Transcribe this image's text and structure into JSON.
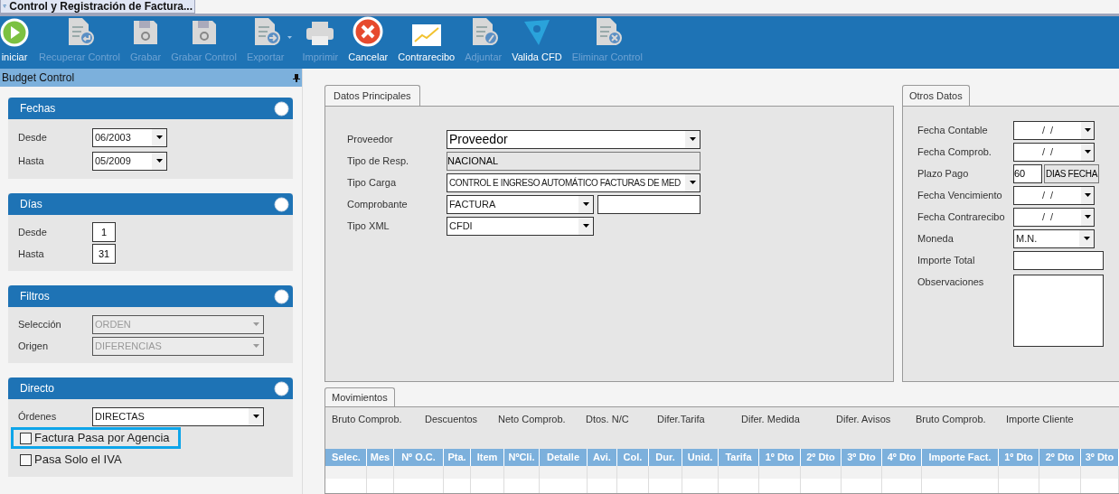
{
  "window": {
    "title": "Control y Registración de Factura..."
  },
  "toolbar": [
    {
      "label": "iniciar",
      "kind": "play",
      "disabled": false
    },
    {
      "label": "Recuperar Control",
      "kind": "doc-return",
      "disabled": true
    },
    {
      "label": "Grabar",
      "kind": "floppy",
      "disabled": true
    },
    {
      "label": "Grabar Control",
      "kind": "floppy",
      "disabled": true
    },
    {
      "label": "Exportar",
      "kind": "doc-export",
      "disabled": true,
      "dropdown": true
    },
    {
      "label": "Imprimir",
      "kind": "printer",
      "disabled": true
    },
    {
      "label": "Cancelar",
      "kind": "cancel",
      "disabled": false
    },
    {
      "label": "Contrarecibo",
      "kind": "chart",
      "disabled": false
    },
    {
      "label": "Adjuntar",
      "kind": "doc-clip",
      "disabled": true
    },
    {
      "label": "Valida CFD",
      "kind": "cfd",
      "disabled": false
    },
    {
      "label": "Eliminar Control",
      "kind": "doc-delete",
      "disabled": true
    }
  ],
  "side_panel": {
    "title": "Budget Control",
    "sections": [
      {
        "title": "Fechas",
        "fields": [
          {
            "label": "Desde",
            "kind": "combo",
            "value": "06/2003",
            "disabled": false
          },
          {
            "label": "Hasta",
            "kind": "combo",
            "value": "05/2009",
            "disabled": false
          }
        ]
      },
      {
        "title": "Días",
        "fields": [
          {
            "label": "Desde",
            "kind": "number",
            "value": "1"
          },
          {
            "label": "Hasta",
            "kind": "number",
            "value": "31"
          }
        ]
      },
      {
        "title": "Filtros",
        "fields": [
          {
            "label": "Selección",
            "kind": "combo-wide",
            "value": "ORDEN",
            "disabled": true
          },
          {
            "label": "Origen",
            "kind": "combo-wide",
            "value": "DIFERENCIAS",
            "disabled": true
          }
        ]
      },
      {
        "title": "Directo",
        "fields": [
          {
            "label": "Órdenes",
            "kind": "combo-wide",
            "value": "DIRECTAS",
            "disabled": false
          },
          {
            "label": "Factura Pasa por Agencia",
            "kind": "checkbox",
            "checked": false,
            "highlighted": true
          },
          {
            "label": "Pasa Solo el IVA",
            "kind": "checkbox",
            "checked": false,
            "highlighted": false
          }
        ]
      }
    ]
  },
  "datos_principales": {
    "tab": "Datos Principales",
    "fields": [
      {
        "label": "Proveedor",
        "kind": "combo-large",
        "value": "Proveedor"
      },
      {
        "label": "Tipo de Resp.",
        "kind": "readonly",
        "value": "NACIONAL"
      },
      {
        "label": "Tipo Carga",
        "kind": "combo",
        "value": "CONTROL E INGRESO AUTOMÁTICO FACTURAS DE MED"
      },
      {
        "label": "Comprobante",
        "kind": "combo-text",
        "value": "FACTURA"
      },
      {
        "label": "Tipo XML",
        "kind": "combo-short",
        "value": "CFDI"
      }
    ]
  },
  "otros_datos": {
    "tab": "Otros Datos",
    "fields": [
      {
        "label": "Fecha Contable",
        "kind": "date",
        "value": "/  /"
      },
      {
        "label": "Fecha Comprob.",
        "kind": "date",
        "value": "/  /"
      },
      {
        "label": "Plazo Pago",
        "kind": "term",
        "value": "60",
        "value_2": "DIAS FECHA"
      },
      {
        "label": "Fecha Vencimiento",
        "kind": "date",
        "value": "/  /"
      },
      {
        "label": "Fecha Contrarecibo",
        "kind": "date",
        "value": "/  /"
      },
      {
        "label": "Moneda",
        "kind": "combo",
        "value": "M.N."
      },
      {
        "label": "Importe Total",
        "kind": "text"
      },
      {
        "label": "Observaciones",
        "kind": "memo"
      }
    ]
  },
  "movimientos": {
    "tab": "Movimientos",
    "totals": [
      "Bruto Comprob.",
      "Descuentos",
      "Neto Comprob.",
      "Dtos. N/C",
      "Difer.Tarifa",
      "Difer. Medida",
      "Difer. Avisos",
      "Bruto Comprob.",
      "Importe Cliente"
    ],
    "columns": [
      "Selec.",
      "Mes",
      "Nº O.C.",
      "Pta.",
      "Item",
      "NºCli.",
      "Detalle",
      "Avi.",
      "Col.",
      "Dur.",
      "Unid.",
      "Tarifa",
      "1º Dto",
      "2º Dto",
      "3º Dto",
      "4º Dto",
      "Importe Fact.",
      "1º Dto",
      "2º Dto",
      "3º Dto"
    ]
  }
}
